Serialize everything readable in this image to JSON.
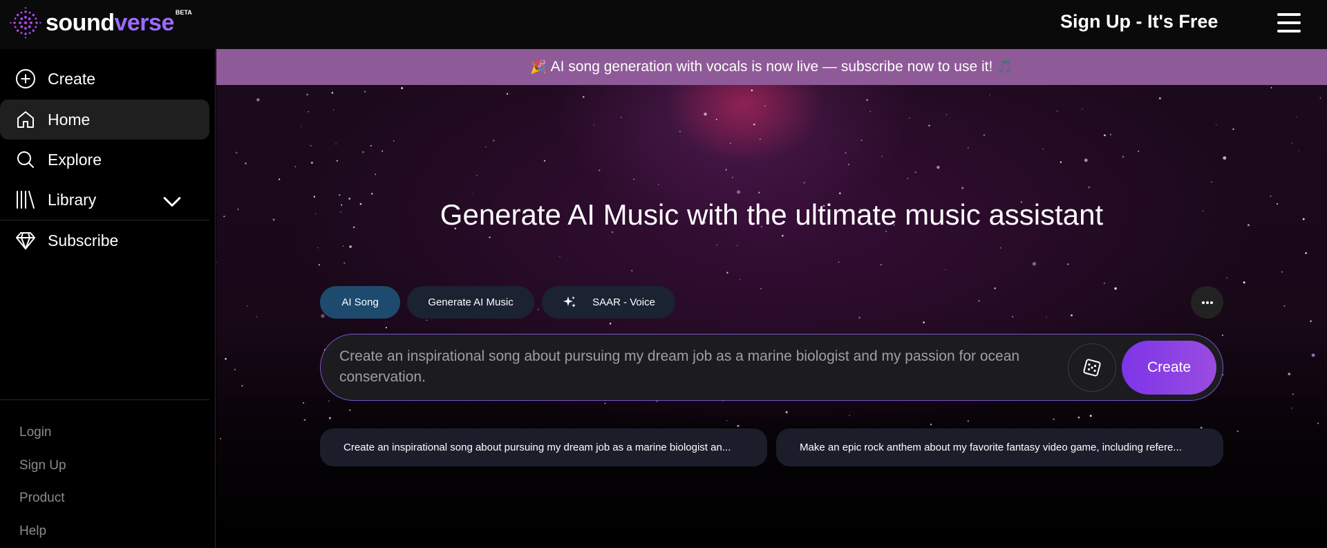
{
  "brand": {
    "name_part1": "sound",
    "name_part2": "verse",
    "badge": "BETA",
    "accent_color": "#9b6bff"
  },
  "header": {
    "signup_label": "Sign Up - It's Free",
    "menu_icon": "hamburger-icon"
  },
  "sidebar": {
    "items": [
      {
        "label": "Create",
        "icon": "plus-circle-icon"
      },
      {
        "label": "Home",
        "icon": "home-icon",
        "active": true
      },
      {
        "label": "Explore",
        "icon": "search-icon"
      },
      {
        "label": "Library",
        "icon": "library-icon",
        "expandable": true
      },
      {
        "label": "Subscribe",
        "icon": "diamond-icon"
      }
    ],
    "footer_links": [
      "Login",
      "Sign Up",
      "Product",
      "Help"
    ]
  },
  "banner": {
    "emoji_left": "🎉",
    "text": "AI song generation with vocals is now live — subscribe now to use it!",
    "emoji_right": "🎵",
    "color": "#8f5a98"
  },
  "hero": {
    "title": "Generate AI Music with the ultimate music assistant"
  },
  "tabs": [
    {
      "label": "AI Song",
      "active": true
    },
    {
      "label": "Generate AI Music",
      "active": false
    },
    {
      "label": "SAAR - Voice",
      "active": false,
      "icon": "sparkles-icon"
    }
  ],
  "prompt": {
    "value": "Create an inspirational song about pursuing my dream job as a marine biologist and my passion for ocean conservation.",
    "create_label": "Create"
  },
  "suggestions": [
    "Create an inspirational song about pursuing my dream job as a marine biologist an...",
    "Make an epic rock anthem about my favorite fantasy video game, including refere..."
  ]
}
